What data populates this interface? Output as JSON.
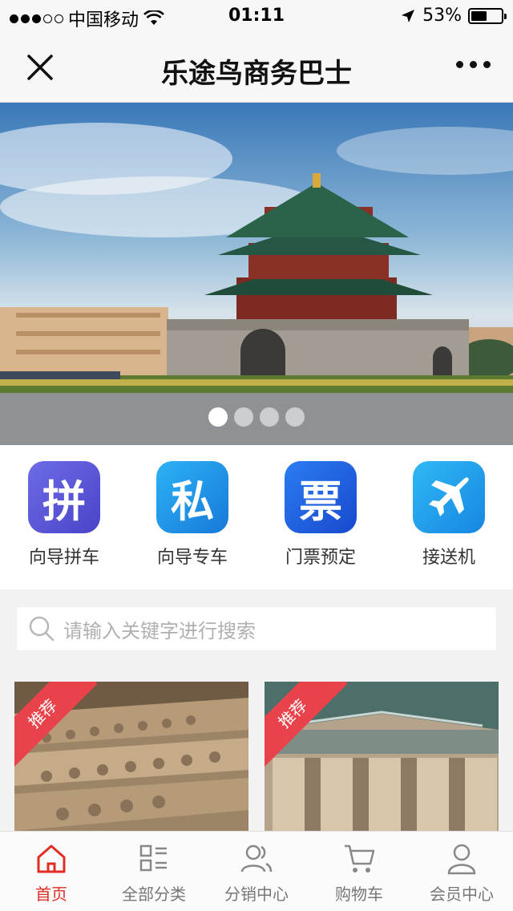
{
  "status_bar": {
    "carrier": "中国移动",
    "time": "01:11",
    "battery": "53%",
    "battery_level": 0.53
  },
  "nav": {
    "title": "乐途鸟商务巴士",
    "close_icon": "close-icon",
    "more_icon": "more-icon"
  },
  "banner": {
    "slide_count": 4,
    "active_index": 0
  },
  "quick_menu": [
    {
      "glyph": "拼",
      "label": "向导拼车",
      "color": "#5b55d6"
    },
    {
      "glyph": "私",
      "label": "向导专车",
      "color": "#1c8ee6"
    },
    {
      "glyph": "票",
      "label": "门票预定",
      "color": "#1f63e0"
    },
    {
      "glyph": "plane-icon",
      "label": "接送机",
      "color": "#1a9be6"
    }
  ],
  "search": {
    "placeholder": "请输入关键字进行搜索"
  },
  "products": [
    {
      "badge": "推荐"
    },
    {
      "badge": "推荐"
    }
  ],
  "tabs": [
    {
      "label": "首页",
      "icon": "home-icon",
      "active": true
    },
    {
      "label": "全部分类",
      "icon": "category-icon",
      "active": false
    },
    {
      "label": "分销中心",
      "icon": "users-icon",
      "active": false
    },
    {
      "label": "购物车",
      "icon": "cart-icon",
      "active": false
    },
    {
      "label": "会员中心",
      "icon": "user-icon",
      "active": false
    }
  ],
  "colors": {
    "accent": "#e02e24",
    "ribbon": "#e8434a"
  }
}
